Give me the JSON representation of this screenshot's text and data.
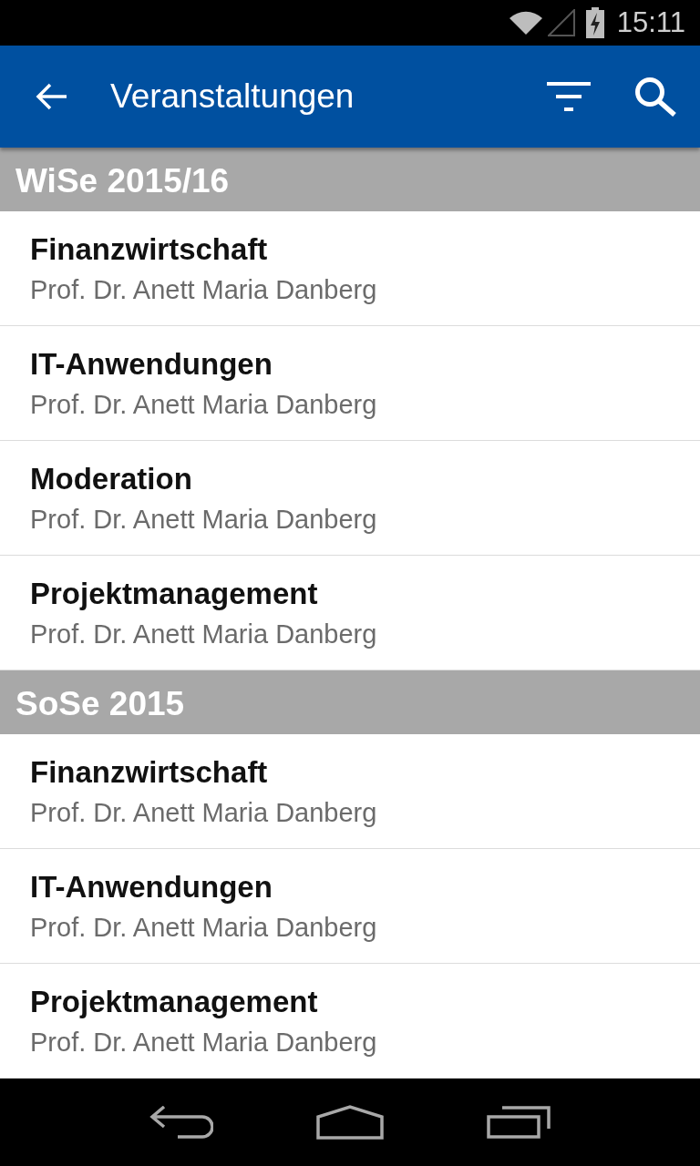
{
  "status_bar": {
    "time": "15:11"
  },
  "app_bar": {
    "title": "Veranstaltungen"
  },
  "sections": [
    {
      "title": "WiSe 2015/16",
      "courses": [
        {
          "name": "Finanzwirtschaft",
          "lecturer": "Prof. Dr. Anett Maria Danberg"
        },
        {
          "name": "IT-Anwendungen",
          "lecturer": "Prof. Dr. Anett Maria Danberg"
        },
        {
          "name": "Moderation",
          "lecturer": "Prof. Dr. Anett Maria Danberg"
        },
        {
          "name": "Projektmanagement",
          "lecturer": "Prof. Dr. Anett Maria Danberg"
        }
      ]
    },
    {
      "title": "SoSe 2015",
      "courses": [
        {
          "name": "Finanzwirtschaft",
          "lecturer": "Prof. Dr. Anett Maria Danberg"
        },
        {
          "name": "IT-Anwendungen",
          "lecturer": "Prof. Dr. Anett Maria Danberg"
        },
        {
          "name": "Projektmanagement",
          "lecturer": "Prof. Dr. Anett Maria Danberg"
        }
      ]
    }
  ]
}
